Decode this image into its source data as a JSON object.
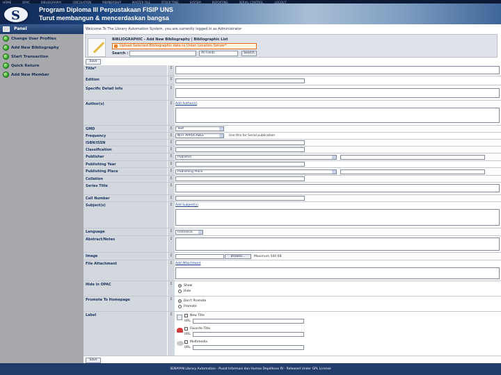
{
  "top_nav": [
    "HOME",
    "OPAC",
    "BIBLIOGRAPHY",
    "CIRCULATION",
    "MEMBERSHIP",
    "MASTER FILE",
    "STOCK TAKE",
    "SYSTEM",
    "REPORTING",
    "SERIAL CONTROL",
    "LOGOUT"
  ],
  "header": {
    "logo_letter": "S",
    "title": "Program Diploma III Perpustakaan FISIP UNS",
    "subtitle": "Turut membangun & mencerdaskan bangsa"
  },
  "sidebar": {
    "panel_title": "Panel",
    "items": [
      {
        "label": "Change User Profiles"
      },
      {
        "label": "Add New Bibliography"
      },
      {
        "label": "Start Transaction"
      },
      {
        "label": "Quick Return"
      },
      {
        "label": "Add New Member"
      }
    ]
  },
  "main": {
    "welcome": "Welcome To The Library Automation System, you are currently logged in as Administrator",
    "box_title": "BIBLIOGRAPHIC - Add New Bibliography  |  Bibliographic List",
    "upload_button": "Upload Selected Bibliographic data to Union Location Server*",
    "search_label": "Search :",
    "search_value": "",
    "search_field": "All Fields",
    "search_button": "Search",
    "save_button": "Save"
  },
  "form": {
    "title": {
      "label": "Title*"
    },
    "edition": {
      "label": "Edition"
    },
    "specific": {
      "label": "Specific Detail Info"
    },
    "authors": {
      "label": "Author(s)",
      "link": "Add Author(s)"
    },
    "gmd": {
      "label": "GMD",
      "value": "Text"
    },
    "frequency": {
      "label": "Frequency",
      "value": "NOT APPLICABLE",
      "hint": "Use this for Serial publication"
    },
    "isbn": {
      "label": "ISBN/ISSN",
      "value": ""
    },
    "classification": {
      "label": "Classification",
      "value": ""
    },
    "publisher": {
      "label": "Publisher",
      "value": "Publisher"
    },
    "publishing_year": {
      "label": "Publishing Year",
      "value": ""
    },
    "publishing_place": {
      "label": "Publishing Place",
      "value": "Publishing Place"
    },
    "collation": {
      "label": "Collation",
      "value": ""
    },
    "series_title": {
      "label": "Series Title",
      "value": ""
    },
    "call_number": {
      "label": "Call Number",
      "value": ""
    },
    "subjects": {
      "label": "Subject(s)",
      "link": "Add Subject(s)"
    },
    "language": {
      "label": "Language",
      "value": "Indonesia"
    },
    "abstract": {
      "label": "Abstract/Notes"
    },
    "image": {
      "label": "Image",
      "browse": "Browse...",
      "hint": "Maximum 500 KB"
    },
    "attachment": {
      "label": "File Attachment",
      "link": "Add Attachment"
    },
    "hide_opac": {
      "label": "Hide in OPAC",
      "options": [
        "Show",
        "Hide"
      ],
      "selected": 0
    },
    "promote": {
      "label": "Promote To Homepage",
      "options": [
        "Don't Promote",
        "Promote"
      ],
      "selected": 0
    },
    "labels": {
      "label": "Label",
      "items": [
        {
          "name": "New Title"
        },
        {
          "name": "Favorite Title"
        },
        {
          "name": "Multimedia"
        }
      ]
    }
  },
  "footer": "SENAYAN Library Automation - Pusat Informasi dan Humas Depdiknas RI - Released Under GPL License"
}
